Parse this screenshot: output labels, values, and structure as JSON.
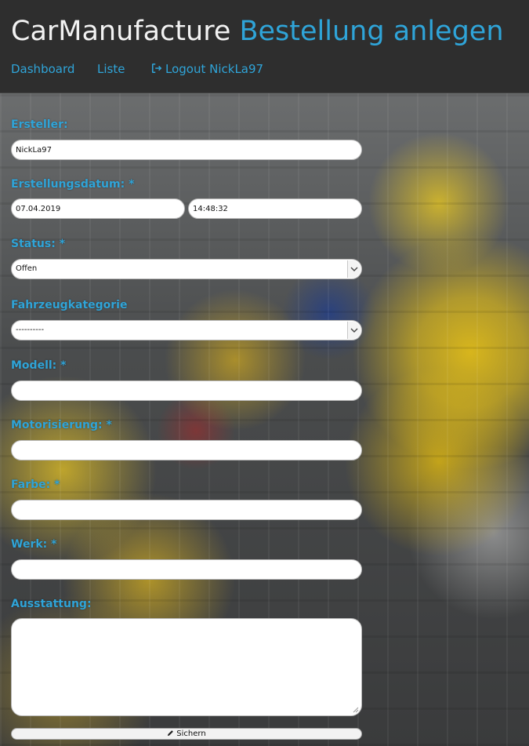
{
  "header": {
    "brand": "CarManufacture",
    "page_title": "Bestellung anlegen",
    "nav": {
      "dashboard": "Dashboard",
      "list": "Liste",
      "logout": "Logout NickLa97",
      "logout_icon": "sign-out-icon"
    }
  },
  "colors": {
    "accent": "#2fa4d8",
    "header_bg": "#2e2e2e"
  },
  "form": {
    "creator": {
      "label": "Ersteller:",
      "value": "NickLa97"
    },
    "created": {
      "label": "Erstellungsdatum: *",
      "date": "07.04.2019",
      "time": "14:48:32"
    },
    "status": {
      "label": "Status: *",
      "selected": "Offen"
    },
    "category": {
      "label": "Fahrzeugkategorie",
      "selected": "----------"
    },
    "model": {
      "label": "Modell: *",
      "value": ""
    },
    "engine": {
      "label": "Motorisierung: *",
      "value": ""
    },
    "color": {
      "label": "Farbe: *",
      "value": ""
    },
    "plant": {
      "label": "Werk: *",
      "value": ""
    },
    "equipment": {
      "label": "Ausstattung:",
      "value": ""
    },
    "save": {
      "label": "Sichern",
      "icon": "pencil-icon"
    }
  }
}
